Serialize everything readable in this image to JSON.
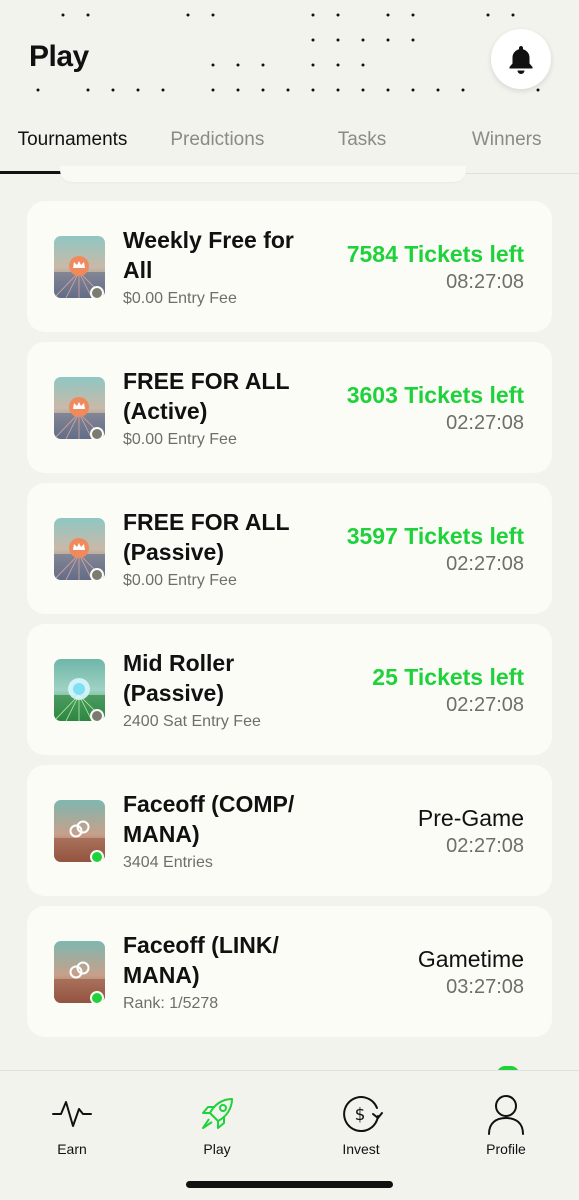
{
  "header": {
    "title": "Play"
  },
  "tabs": [
    {
      "label": "Tournaments",
      "active": true
    },
    {
      "label": "Predictions",
      "active": false
    },
    {
      "label": "Tasks",
      "active": false
    },
    {
      "label": "Winners",
      "active": false
    }
  ],
  "cards": [
    {
      "title": "Weekly Free for All",
      "subtitle": "$0.00 Entry Fee",
      "status": "7584 Tickets left",
      "time": "08:27:08",
      "status_color": "#1fd13a",
      "dot": "grey",
      "thumb": "crown-icon"
    },
    {
      "title": "FREE FOR ALL (Active)",
      "subtitle": "$0.00 Entry Fee",
      "status": "3603 Tickets left",
      "time": "02:27:08",
      "status_color": "#1fd13a",
      "dot": "grey",
      "thumb": "crown-icon"
    },
    {
      "title": "FREE FOR ALL (Passive)",
      "subtitle": "$0.00 Entry Fee",
      "status": "3597 Tickets left",
      "time": "02:27:08",
      "status_color": "#1fd13a",
      "dot": "grey",
      "thumb": "crown-icon"
    },
    {
      "title": "Mid Roller (Passive)",
      "subtitle": "2400 Sat Entry Fee",
      "status": "25 Tickets left",
      "time": "02:27:08",
      "status_color": "#1fd13a",
      "dot": "grey",
      "thumb": "orb-icon"
    },
    {
      "title": "Faceoff (COMP/ MANA)",
      "subtitle": "3404 Entries",
      "status": "Pre-Game",
      "time": "02:27:08",
      "status_color": "#111111",
      "dot": "green",
      "thumb": "link-icon"
    },
    {
      "title": "Faceoff (LINK/ MANA)",
      "subtitle": "Rank: 1/5278",
      "status": "Gametime",
      "time": "03:27:08",
      "status_color": "#111111",
      "dot": "green",
      "thumb": "link-icon"
    }
  ],
  "nav": [
    {
      "label": "Earn",
      "icon": "pulse-icon"
    },
    {
      "label": "Play",
      "icon": "rocket-icon",
      "active": true
    },
    {
      "label": "Invest",
      "icon": "dollar-cycle-icon"
    },
    {
      "label": "Profile",
      "icon": "user-icon"
    }
  ],
  "colors": {
    "accent": "#1fd13a",
    "background": "#f3f3ee",
    "card": "#fcfcf7"
  }
}
